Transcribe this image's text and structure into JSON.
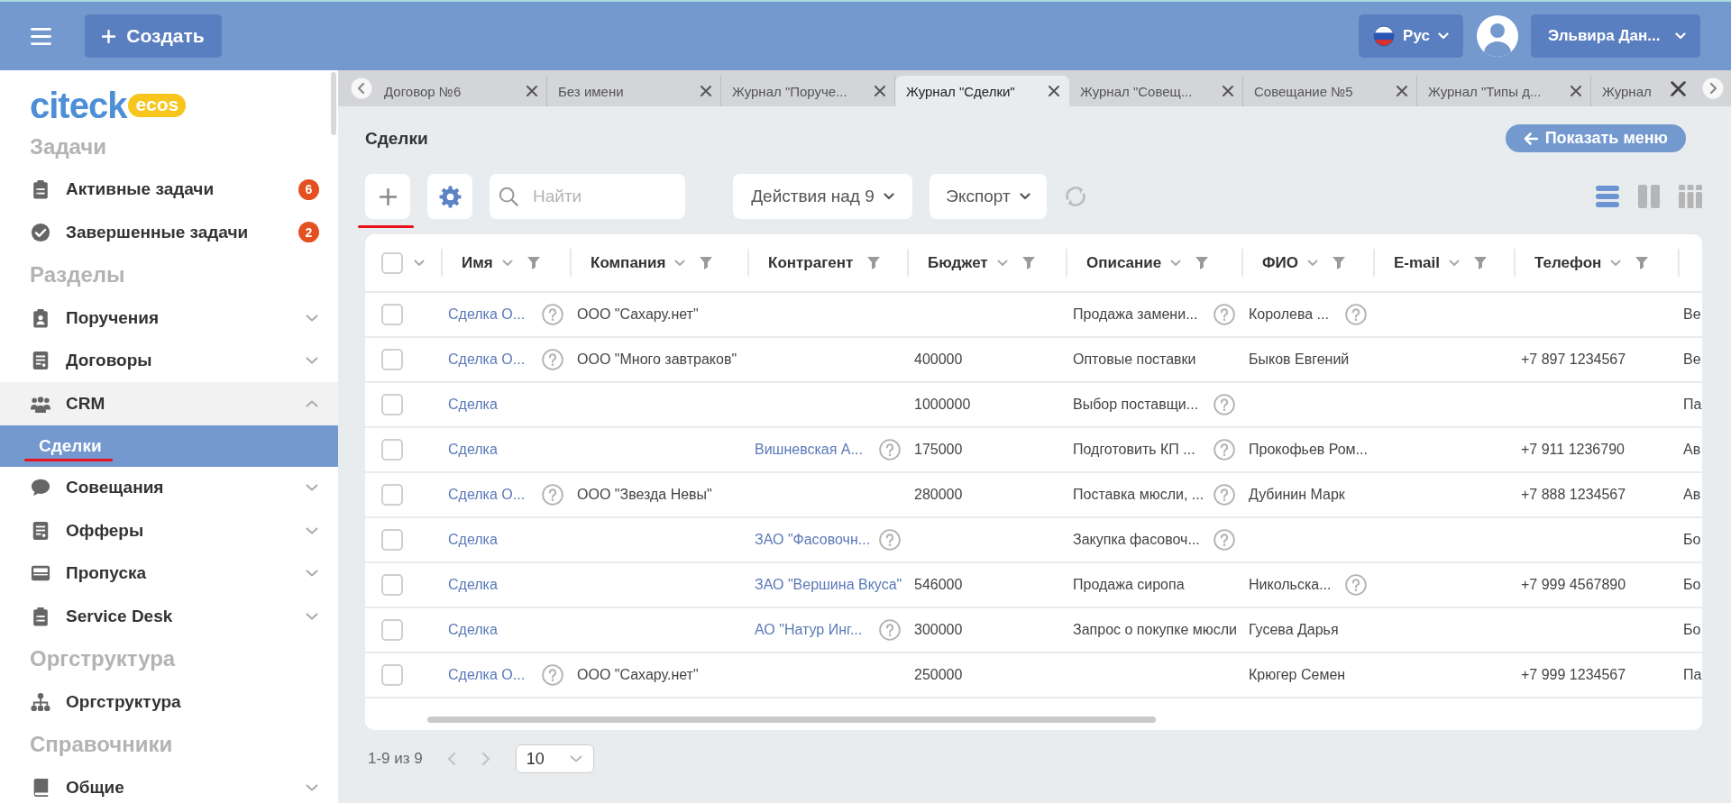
{
  "header": {
    "create_button": "Создать",
    "language": "Рус",
    "user": "Эльвира Дан..."
  },
  "sidebar": {
    "logo": {
      "name": "citeck",
      "badge": "ecos"
    },
    "sections": [
      {
        "title": "Задачи",
        "items": [
          {
            "label": "Активные задачи",
            "badge": "6",
            "selected": false
          },
          {
            "label": "Завершенные задачи",
            "badge": "2",
            "selected": false
          }
        ]
      },
      {
        "title": "Разделы",
        "items": [
          {
            "label": "Поручения",
            "expanded": false,
            "selected": false
          },
          {
            "label": "Договоры",
            "expanded": false,
            "selected": false
          },
          {
            "label": "CRM",
            "expanded": true,
            "selected": false,
            "children": [
              {
                "label": "Сделки",
                "selected": true,
                "underlined": true
              }
            ]
          },
          {
            "label": "Совещания",
            "expanded": false,
            "selected": false
          },
          {
            "label": "Офферы",
            "expanded": false,
            "selected": false
          },
          {
            "label": "Пропуска",
            "expanded": false,
            "selected": false
          },
          {
            "label": "Service Desk",
            "expanded": false,
            "selected": false
          }
        ]
      },
      {
        "title": "Оргструктура",
        "items": [
          {
            "label": "Оргструктура",
            "selected": false
          }
        ]
      },
      {
        "title": "Справочники",
        "items": [
          {
            "label": "Общие",
            "expanded": false,
            "selected": false
          }
        ]
      }
    ]
  },
  "tabs": [
    {
      "label": "Договор №6",
      "selected": false,
      "closable": true
    },
    {
      "label": "Без имени",
      "selected": false,
      "closable": true
    },
    {
      "label": "Журнал \"Поруче...",
      "selected": false,
      "closable": true
    },
    {
      "label": "Журнал \"Сделки\"",
      "selected": true,
      "closable": true
    },
    {
      "label": "Журнал \"Совещ...",
      "selected": false,
      "closable": true
    },
    {
      "label": "Совещание №5",
      "selected": false,
      "closable": true
    },
    {
      "label": "Журнал \"Типы д...",
      "selected": false,
      "closable": true
    },
    {
      "label": "Журнал",
      "selected": false,
      "closable": false
    }
  ],
  "page": {
    "title": "Сделки",
    "show_menu_button": "Показать меню"
  },
  "toolbar": {
    "add_button": {
      "underlined": true
    },
    "search": {
      "placeholder": "Найти"
    },
    "actions_button": "Действия над 9",
    "export_button": "Экспорт",
    "views": [
      {
        "selected": true
      },
      {
        "selected": false
      },
      {
        "selected": false
      }
    ]
  },
  "table": {
    "select_all": {
      "checked": false
    },
    "columns": [
      {
        "label": "Имя",
        "sortable": true
      },
      {
        "label": "Компания",
        "sortable": true
      },
      {
        "label": "Контрагент",
        "sortable": false
      },
      {
        "label": "Бюджет",
        "sortable": true
      },
      {
        "label": "Описание",
        "sortable": true
      },
      {
        "label": "ФИО",
        "sortable": true
      },
      {
        "label": "E-mail",
        "sortable": true
      },
      {
        "label": "Телефон",
        "sortable": true
      }
    ],
    "rows": [
      {
        "checked": false,
        "cells": [
          {
            "text": "Сделка О...",
            "link": true,
            "hint": true
          },
          {
            "text": "ООО \"Сахару.нет\"",
            "link": false,
            "hint": false
          },
          null,
          null,
          {
            "text": "Продажа замени...",
            "link": false,
            "hint": true
          },
          {
            "text": "Королева ...",
            "link": false,
            "hint": true
          },
          null,
          null,
          {
            "text": "Ве",
            "link": false,
            "hint": false
          }
        ]
      },
      {
        "checked": false,
        "cells": [
          {
            "text": "Сделка О...",
            "link": true,
            "hint": true
          },
          {
            "text": "ООО \"Много завтраков\"",
            "link": false,
            "hint": false
          },
          null,
          {
            "text": "400000",
            "link": false,
            "hint": false
          },
          {
            "text": "Оптовые поставки",
            "link": false,
            "hint": false
          },
          {
            "text": "Быков Евгений",
            "link": false,
            "hint": false
          },
          null,
          {
            "text": "+7 897 1234567",
            "link": false,
            "hint": false
          },
          {
            "text": "Ве",
            "link": false,
            "hint": false
          }
        ]
      },
      {
        "checked": false,
        "cells": [
          {
            "text": "Сделка",
            "link": true,
            "hint": false
          },
          null,
          null,
          {
            "text": "1000000",
            "link": false,
            "hint": false
          },
          {
            "text": "Выбор поставщи...",
            "link": false,
            "hint": true
          },
          null,
          null,
          null,
          {
            "text": "Па",
            "link": false,
            "hint": false
          }
        ]
      },
      {
        "checked": false,
        "cells": [
          {
            "text": "Сделка",
            "link": true,
            "hint": false
          },
          null,
          {
            "text": "Вишневская А...",
            "link": true,
            "hint": true
          },
          {
            "text": "175000",
            "link": false,
            "hint": false
          },
          {
            "text": "Подготовить КП ...",
            "link": false,
            "hint": true
          },
          {
            "text": "Прокофьев Ром...",
            "link": false,
            "hint": false
          },
          null,
          {
            "text": "+7 911 1236790",
            "link": false,
            "hint": false
          },
          {
            "text": "Ав",
            "link": false,
            "hint": false
          }
        ]
      },
      {
        "checked": false,
        "cells": [
          {
            "text": "Сделка О...",
            "link": true,
            "hint": true
          },
          {
            "text": "ООО \"Звезда Невы\"",
            "link": false,
            "hint": false
          },
          null,
          {
            "text": "280000",
            "link": false,
            "hint": false
          },
          {
            "text": "Поставка мюсли, ...",
            "link": false,
            "hint": true
          },
          {
            "text": "Дубинин Марк",
            "link": false,
            "hint": false
          },
          null,
          {
            "text": "+7 888 1234567",
            "link": false,
            "hint": false
          },
          {
            "text": "Ав",
            "link": false,
            "hint": false
          }
        ]
      },
      {
        "checked": false,
        "cells": [
          {
            "text": "Сделка",
            "link": true,
            "hint": false
          },
          null,
          {
            "text": "ЗАО \"Фасовочн...",
            "link": true,
            "hint": true
          },
          null,
          {
            "text": "Закупка фасовоч...",
            "link": false,
            "hint": true
          },
          null,
          null,
          null,
          {
            "text": "Бо",
            "link": false,
            "hint": false
          }
        ]
      },
      {
        "checked": false,
        "cells": [
          {
            "text": "Сделка",
            "link": true,
            "hint": false
          },
          null,
          {
            "text": "ЗАО \"Вершина Вкуса\"",
            "link": true,
            "hint": false
          },
          {
            "text": "546000",
            "link": false,
            "hint": false
          },
          {
            "text": "Продажа сиропа",
            "link": false,
            "hint": false
          },
          {
            "text": "Никольска...",
            "link": false,
            "hint": true
          },
          null,
          {
            "text": "+7 999 4567890",
            "link": false,
            "hint": false
          },
          {
            "text": "Бо",
            "link": false,
            "hint": false
          }
        ]
      },
      {
        "checked": false,
        "cells": [
          {
            "text": "Сделка",
            "link": true,
            "hint": false
          },
          null,
          {
            "text": "АО \"Натур Инг...",
            "link": true,
            "hint": true
          },
          {
            "text": "300000",
            "link": false,
            "hint": false
          },
          {
            "text": "Запрос о покупке мюсли",
            "link": false,
            "hint": false
          },
          {
            "text": "Гусева Дарья",
            "link": false,
            "hint": false
          },
          null,
          null,
          {
            "text": "Бо",
            "link": false,
            "hint": false
          }
        ]
      },
      {
        "checked": false,
        "cells": [
          {
            "text": "Сделка О...",
            "link": true,
            "hint": true
          },
          {
            "text": "ООО \"Сахару.нет\"",
            "link": false,
            "hint": false
          },
          null,
          {
            "text": "250000",
            "link": false,
            "hint": false
          },
          null,
          {
            "text": "Крюгер Семен",
            "link": false,
            "hint": false
          },
          null,
          {
            "text": "+7 999 1234567",
            "link": false,
            "hint": false
          },
          {
            "text": "Па",
            "link": false,
            "hint": false
          }
        ]
      }
    ]
  },
  "pagination": {
    "range": "1-9 из 9",
    "prev": {
      "disabled": true
    },
    "next": {
      "disabled": true
    },
    "page_size": "10"
  }
}
